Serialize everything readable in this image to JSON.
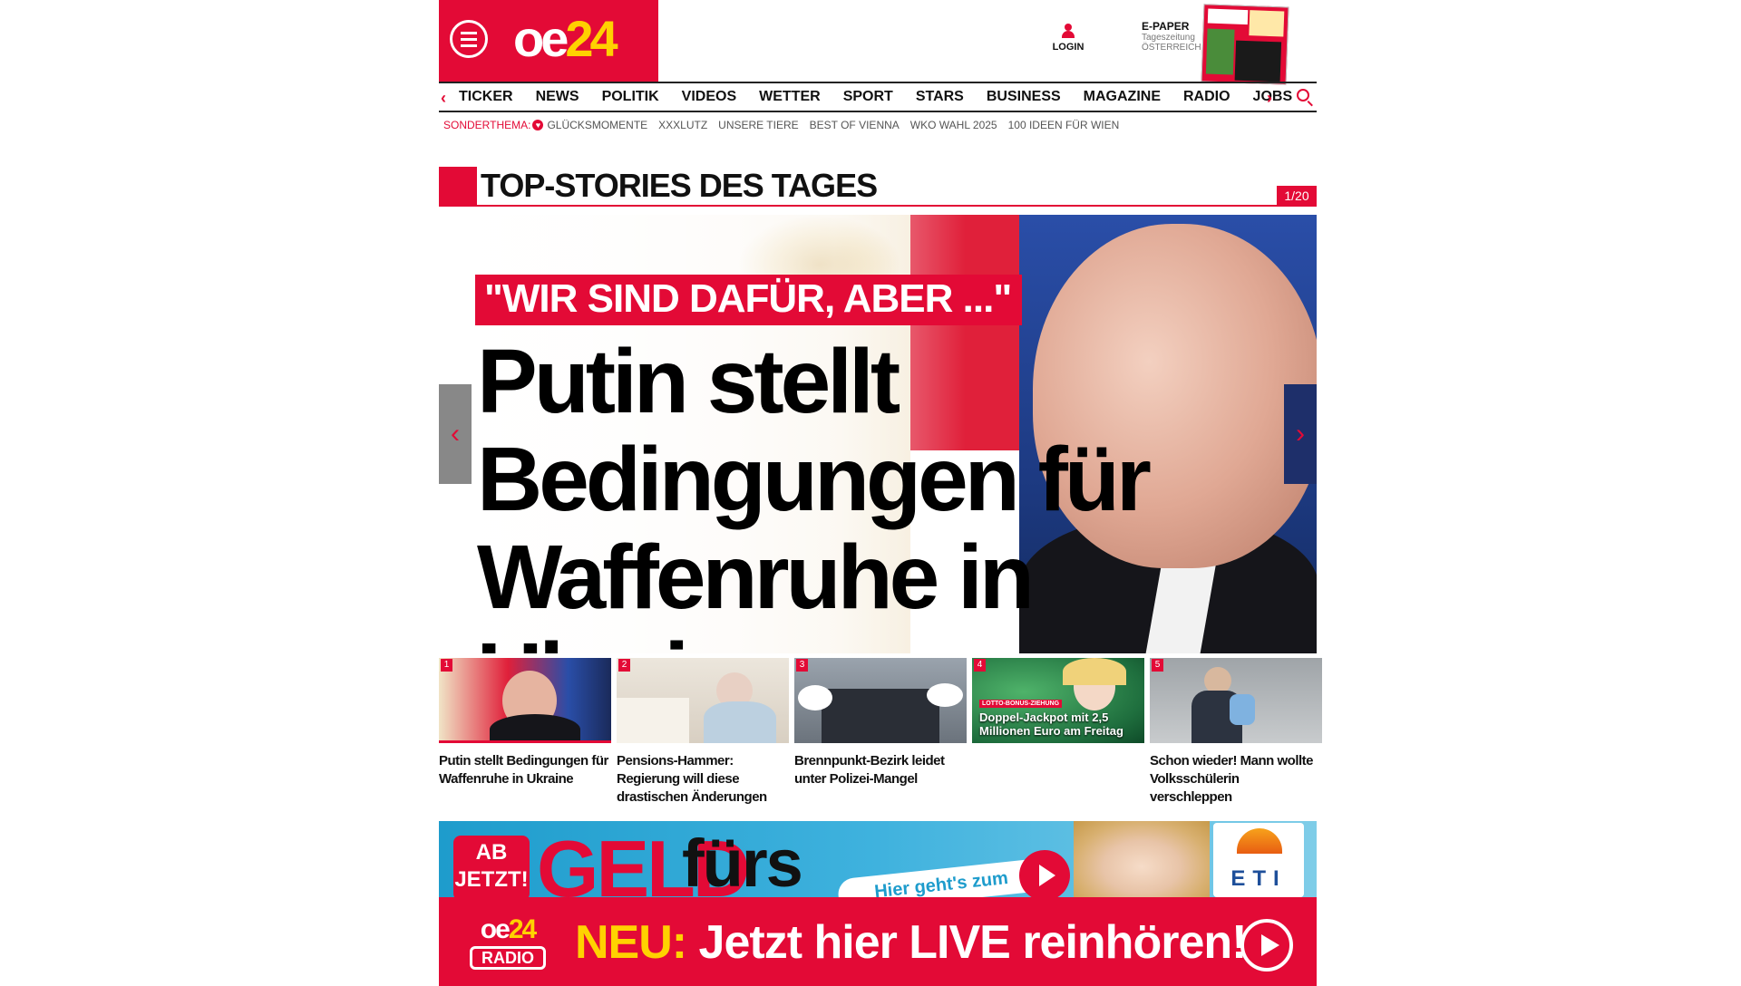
{
  "header": {
    "logo": {
      "part1": "oe",
      "part2": "24"
    },
    "login_label": "LOGIN",
    "epaper": {
      "title": "E-PAPER",
      "sub1": "Tageszeitung",
      "sub2": "ÖSTERREICH"
    }
  },
  "nav": {
    "items": [
      "TICKER",
      "NEWS",
      "POLITIK",
      "VIDEOS",
      "WETTER",
      "SPORT",
      "STARS",
      "BUSINESS",
      "MAGAZINE",
      "RADIO",
      "JOBS"
    ],
    "prev_glyph": "‹",
    "next_glyph": "›"
  },
  "special": {
    "label": "SONDERTHEMA:",
    "items": [
      "GLÜCKSMOMENTE",
      "XXXLUTZ",
      "UNSERE TIERE",
      "BEST OF VIENNA",
      "WKO WAHL 2025",
      "100 IDEEN FÜR WIEN"
    ]
  },
  "top_stories": {
    "title": "TOP-STORIES DES TAGES",
    "counter": "1/20"
  },
  "hero": {
    "kicker": "\"WIR SIND DAFÜR, ABER ...\"",
    "headline": "Putin stellt Bedingungen für Waffenruhe in Ukraine",
    "prev_glyph": "‹",
    "next_glyph": "›"
  },
  "thumbs": [
    {
      "num": "1",
      "title": "Putin stellt Bedingungen für Waffenruhe in Ukraine"
    },
    {
      "num": "2",
      "title": "Pensions-Hammer: Regierung will diese drastischen Änderungen"
    },
    {
      "num": "3",
      "title": "Brennpunkt-Bezirk leidet unter Polizei-Mangel"
    },
    {
      "num": "4",
      "title": "",
      "tag": "LOTTO-BONUS-ZIEHUNG",
      "overlay": "Doppel-Jackpot mit 2,5 Millionen Euro am Freitag"
    },
    {
      "num": "5",
      "title": "Schon wieder! Mann wollte Volksschülerin verschleppen"
    }
  ],
  "ad": {
    "badge_line1": "AB",
    "badge_line2": "JETZT!",
    "big1": "GELD",
    "big2": "fürs",
    "pill": "Hier geht's zum",
    "brand": "ETI"
  },
  "radio": {
    "logo_part1": "oe",
    "logo_part2": "24",
    "logo_label": "RADIO",
    "neu": "NEU:",
    "text": " Jetzt hier LIVE reinhören!"
  },
  "colors": {
    "accent": "#e30a36",
    "logo_yellow": "#ffd200",
    "text": "#111111"
  }
}
